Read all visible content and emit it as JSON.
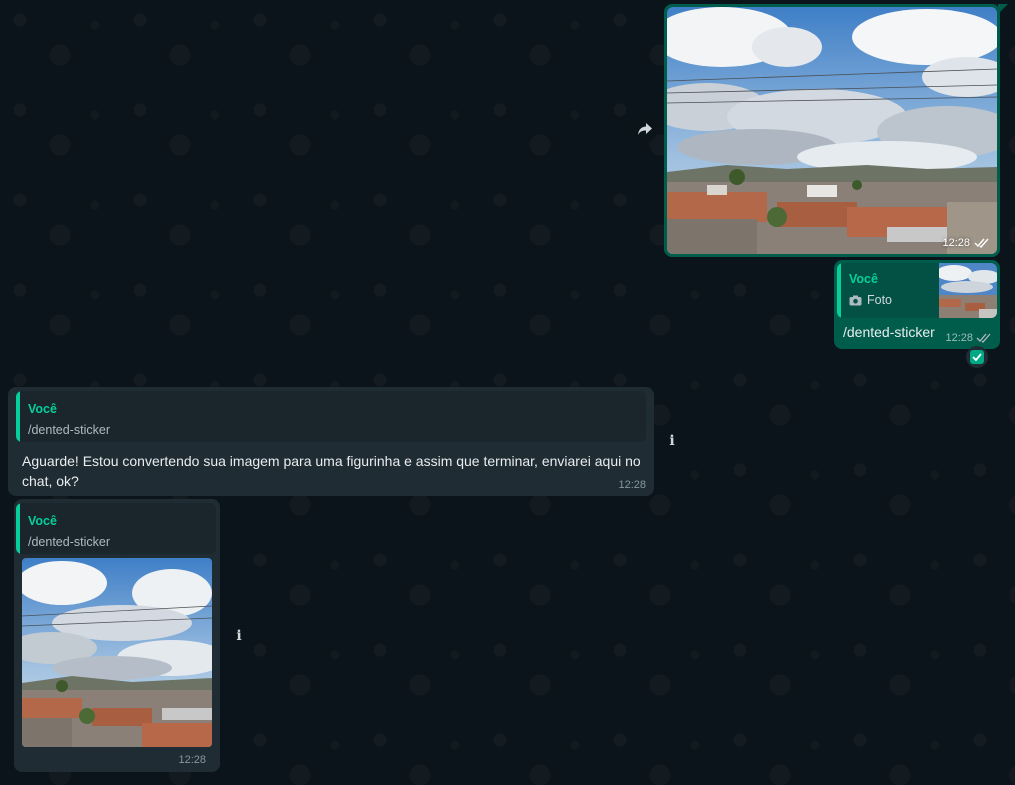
{
  "chat": {
    "outgoing_image": {
      "time": "12:28",
      "status_icon": "double-check-icon"
    },
    "outgoing_reply": {
      "quote_author": "Você",
      "quote_type_icon": "camera-icon",
      "quote_type": "Foto",
      "text": "/dented-sticker",
      "time": "12:28",
      "status_icon": "double-check-icon"
    },
    "incoming_text": {
      "quote_author": "Você",
      "quote_text": "/dented-sticker",
      "text": "Aguarde! Estou convertendo sua imagem para uma figurinha e assim que terminar, enviarei aqui no chat, ok?",
      "time": "12:28"
    },
    "incoming_image": {
      "quote_author": "Você",
      "quote_text": "/dented-sticker",
      "time": "12:28"
    }
  },
  "colors": {
    "background": "#0b141a",
    "outgoing_bubble": "#005c4b",
    "incoming_bubble": "#1f2c33",
    "accent": "#06cf9c"
  }
}
